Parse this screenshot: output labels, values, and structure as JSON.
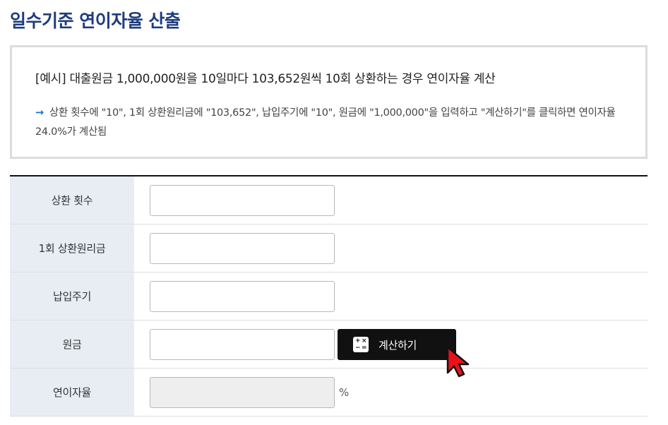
{
  "page": {
    "title": "일수기준 연이자율 산출"
  },
  "example": {
    "title": "[예시] 대출원금 1,000,000원을 10일마다 103,652원씩 10회 상환하는 경우 연이자율 계산",
    "arrow": "→",
    "description": "상환 횟수에 \"10\", 1회 상환원리금에 \"103,652\", 납입주기에 \"10\", 원금에 \"1,000,000\"을 입력하고 \"계산하기\"를 클릭하면 연이자율 24.0%가 계산됨"
  },
  "form": {
    "rows": [
      {
        "label": "상환 횟수",
        "value": ""
      },
      {
        "label": "1회 상환원리금",
        "value": ""
      },
      {
        "label": "납입주기",
        "value": ""
      },
      {
        "label": "원금",
        "value": ""
      },
      {
        "label": "연이자율",
        "value": ""
      }
    ],
    "calc_button_label": "계산하기",
    "rate_unit": "%"
  },
  "icons": {
    "calculator": "calculator-icon",
    "cursor": "mouse-pointer-icon",
    "arrow": "arrow-right-icon"
  },
  "colors": {
    "title": "#1f3c7e",
    "label_bg": "#e8edf3",
    "button_bg": "#111111",
    "cursor_fill": "#e8121a"
  }
}
